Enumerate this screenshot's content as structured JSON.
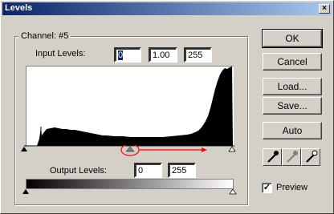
{
  "window": {
    "title": "Levels",
    "close_glyph": "×"
  },
  "channel": {
    "label": "Channel:",
    "value": "#5"
  },
  "input_levels": {
    "label": "Input Levels:",
    "black": "0",
    "gamma": "1.00",
    "white": "255"
  },
  "output_levels": {
    "label": "Output Levels:",
    "black": "0",
    "white": "255"
  },
  "buttons": {
    "ok": "OK",
    "cancel": "Cancel",
    "load": "Load...",
    "save": "Save...",
    "auto": "Auto"
  },
  "preview": {
    "label": "Preview",
    "checked": true,
    "check_glyph": "✓"
  },
  "icons": [
    "black-eyedropper-icon",
    "gray-eyedropper-icon",
    "white-eyedropper-icon"
  ],
  "colors": {
    "title_start": "#0a246a",
    "title_end": "#a6caf0",
    "annotation": "#ff0000"
  }
}
